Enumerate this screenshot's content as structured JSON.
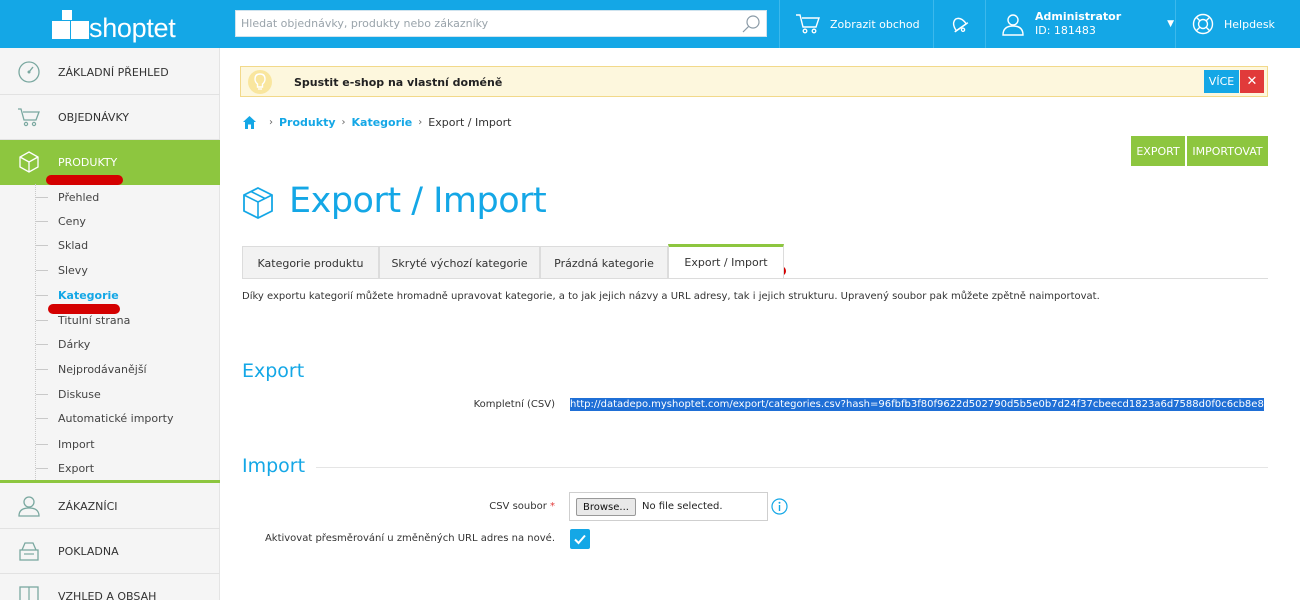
{
  "header": {
    "logo_text": "shoptet",
    "search_placeholder": "Hledat objednávky, produkty nebo zákazníky",
    "show_store_label": "Zobrazit obchod",
    "admin_name": "Administrator",
    "admin_id": "ID: 181483",
    "helpdesk_label": "Helpdesk",
    "color": "#14a7e6"
  },
  "sidebar": {
    "main": [
      {
        "label": "ZÁKLADNÍ PŘEHLED",
        "icon": "dashboard-gauge-icon"
      },
      {
        "label": "OBJEDNÁVKY",
        "icon": "cart-icon"
      },
      {
        "label": "PRODUKTY",
        "icon": "box-icon",
        "active": true
      },
      {
        "label": "ZÁKAZNÍCI",
        "icon": "user-icon"
      },
      {
        "label": "POKLADNA",
        "icon": "cash-register-icon"
      },
      {
        "label": "VZHLED A OBSAH",
        "icon": "layout-icon"
      }
    ],
    "sub": [
      {
        "label": "Přehled"
      },
      {
        "label": "Ceny"
      },
      {
        "label": "Sklad"
      },
      {
        "label": "Slevy"
      },
      {
        "label": "Kategorie",
        "active": true
      },
      {
        "label": "Titulní strana"
      },
      {
        "label": "Dárky"
      },
      {
        "label": "Nejprodávanější"
      },
      {
        "label": "Diskuse"
      },
      {
        "label": "Automatické importy"
      },
      {
        "label": "Import"
      },
      {
        "label": "Export"
      }
    ],
    "active_color": "#8dc63f"
  },
  "notice": {
    "text": "Spustit e-shop na vlastní doméně",
    "more_label": "VÍCE",
    "close_label": "✕"
  },
  "breadcrumb": {
    "items": [
      "Produkty",
      "Kategorie"
    ],
    "current": "Export / Import",
    "separator": "›"
  },
  "actions": {
    "export_label": "EXPORT",
    "import_label": "IMPORTOVAT"
  },
  "page": {
    "title": "Export / Import",
    "tabs": [
      {
        "label": "Kategorie produktu"
      },
      {
        "label": "Skryté výchozí kategorie"
      },
      {
        "label": "Prázdná kategorie"
      },
      {
        "label": "Export / Import",
        "active": true
      }
    ],
    "description": "Díky exportu kategorií můžete hromadně upravovat kategorie, a to jak jejich názvy a URL adresy, tak i jejich strukturu. Upravený soubor pak můžete zpětně naimportovat."
  },
  "export": {
    "title": "Export",
    "complete_label": "Kompletní (CSV)",
    "complete_url": "http://datadepo.myshoptet.com/export/categories.csv?hash=96fbfb3f80f9622d502790d5b5e0b7d24f37cbeecd1823a6d7588d0f0c6cb8e8"
  },
  "import": {
    "title": "Import",
    "csv_label": "CSV soubor",
    "required_mark": "*",
    "browse_label": "Browse...",
    "file_status": "No file selected.",
    "redirect_label": "Aktivovat přesměrování u změněných URL adres na nové.",
    "redirect_checked": true
  },
  "colors": {
    "primary": "#14a7e6",
    "green": "#8dc63f",
    "danger": "#e13a3a",
    "annotation_red": "#d40000"
  }
}
